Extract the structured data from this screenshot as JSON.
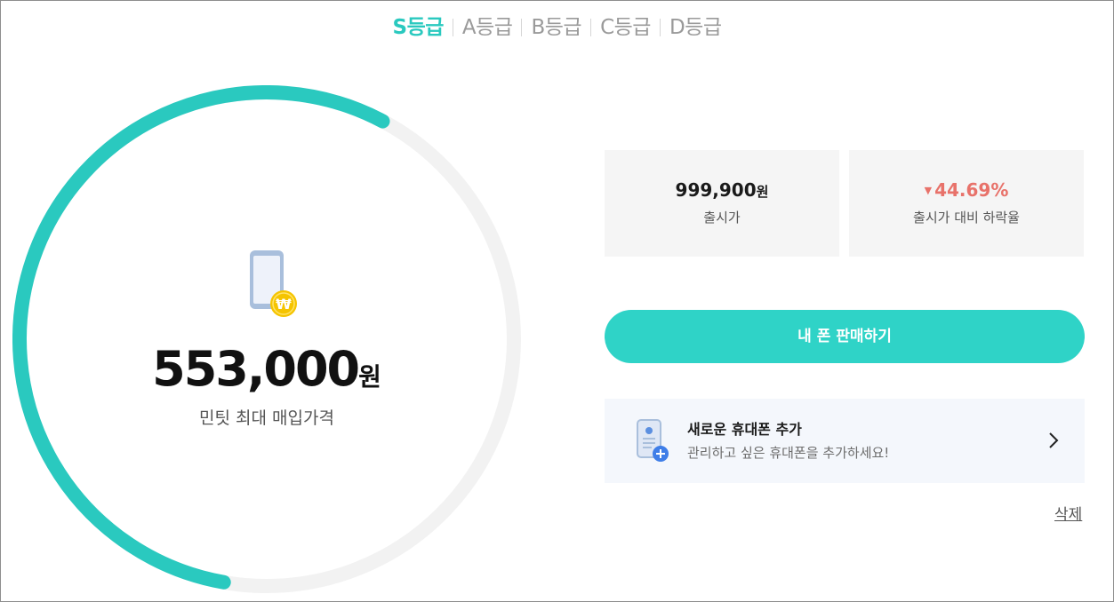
{
  "grade_tabs": [
    {
      "label": "S등급",
      "active": true
    },
    {
      "label": "A등급",
      "active": false
    },
    {
      "label": "B등급",
      "active": false
    },
    {
      "label": "C등급",
      "active": false
    },
    {
      "label": "D등급",
      "active": false
    }
  ],
  "gauge": {
    "progress_fraction": 0.55,
    "accent_color": "#2ac9bf",
    "track_color": "#f2f2f2",
    "icon": "phone-won-icon",
    "coin_symbol": "₩",
    "price_value": "553,000",
    "price_unit": "원",
    "caption": "민팃 최대 매입가격"
  },
  "release_price": {
    "value": "999,900",
    "unit": "원",
    "label": "출시가"
  },
  "drop_rate": {
    "value": "44.69%",
    "label": "출시가 대비 하락율",
    "icon": "down-triangle-icon",
    "color": "#e8726a"
  },
  "sell_button": {
    "label": "내 폰 판매하기",
    "color": "#2fd3c7"
  },
  "add_phone": {
    "title": "새로운 휴대폰 추가",
    "description": "관리하고 싶은 휴대폰을 추가하세요!",
    "icon": "phone-add-icon",
    "chevron_icon": "chevron-right-icon"
  },
  "delete_link": "삭제"
}
